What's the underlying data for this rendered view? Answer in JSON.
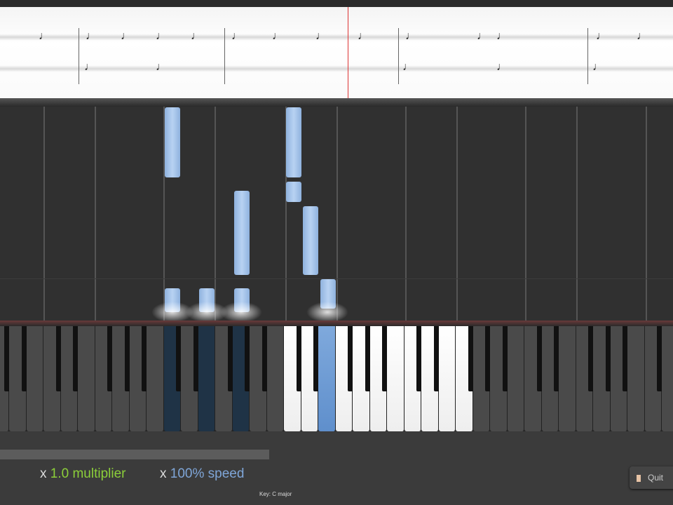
{
  "sheet_music": {
    "label": "sheet-music-staff"
  },
  "falling_notes": {
    "color": "#a8c6ec"
  },
  "keyboard": {
    "lit_range": [
      "C4",
      "F5"
    ],
    "pressed_keys": [
      "C3",
      "E3",
      "G3"
    ],
    "highlighted_key": "E4",
    "highlight_color": "#6f9bd4"
  },
  "footer": {
    "multiplier_prefix": "x",
    "multiplier_value": "1.0 multiplier",
    "speed_prefix": "x",
    "speed_value": "100% speed",
    "key_label": "Key: C major",
    "quit_label": "Quit",
    "progress_percent": 40
  }
}
